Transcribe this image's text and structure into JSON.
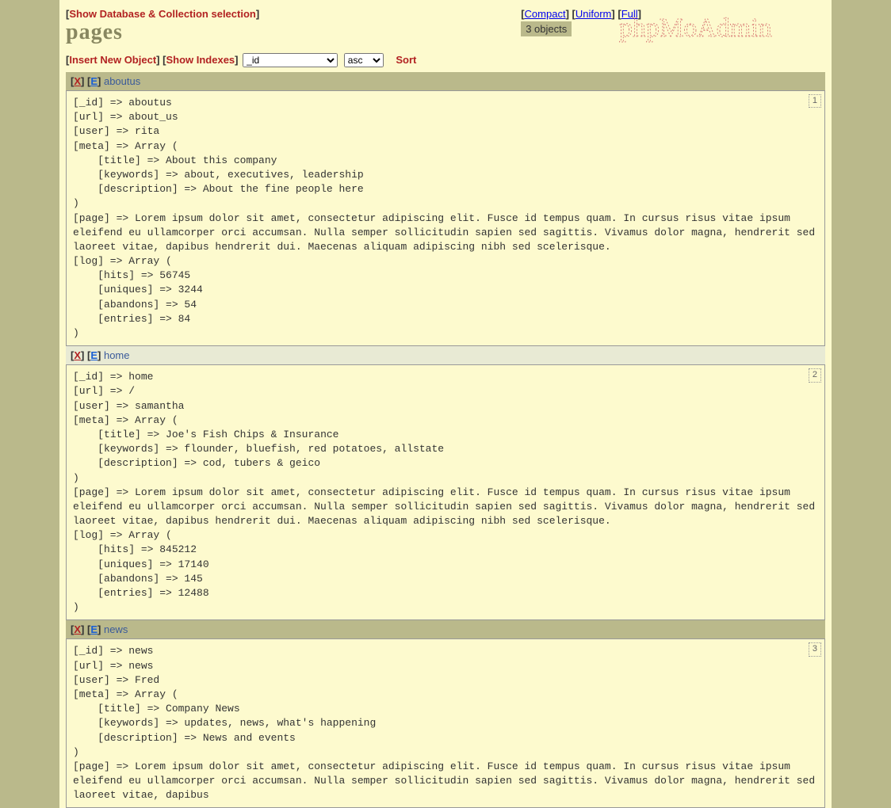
{
  "header": {
    "show_db_link": "Show Database & Collection selection",
    "collection_title": "pages",
    "insert_link": "Insert New Object",
    "show_indexes_link": "Show Indexes",
    "sort_field": "_id",
    "sort_dir": "asc",
    "sort_label": "Sort",
    "view_compact": "Compact",
    "view_uniform": "Uniform",
    "view_full": "Full",
    "object_count": "3 objects",
    "logo_text": "phpMoAdmin"
  },
  "actions": {
    "x": "X",
    "e": "E"
  },
  "documents": [
    {
      "index": "1",
      "header_class": "",
      "id_label": "aboutus",
      "body": "[_id] => aboutus\n[url] => about_us\n[user] => rita\n[meta] => Array (\n    [title] => About this company\n    [keywords] => about, executives, leadership\n    [description] => About the fine people here\n)\n[page] => Lorem ipsum dolor sit amet, consectetur adipiscing elit. Fusce id tempus quam. In cursus risus vitae ipsum eleifend eu ullamcorper orci accumsan. Nulla semper sollicitudin sapien sed sagittis. Vivamus dolor magna, hendrerit sed laoreet vitae, dapibus hendrerit dui. Maecenas aliquam adipiscing nibh sed scelerisque.\n[log] => Array (\n    [hits] => 56745\n    [uniques] => 3244\n    [abandons] => 54\n    [entries] => 84\n)"
    },
    {
      "index": "2",
      "header_class": "alt",
      "id_label": "home",
      "body": "[_id] => home\n[url] => /\n[user] => samantha\n[meta] => Array (\n    [title] => Joe's Fish Chips & Insurance\n    [keywords] => flounder, bluefish, red potatoes, allstate\n    [description] => cod, tubers & geico\n)\n[page] => Lorem ipsum dolor sit amet, consectetur adipiscing elit. Fusce id tempus quam. In cursus risus vitae ipsum eleifend eu ullamcorper orci accumsan. Nulla semper sollicitudin sapien sed sagittis. Vivamus dolor magna, hendrerit sed laoreet vitae, dapibus hendrerit dui. Maecenas aliquam adipiscing nibh sed scelerisque.\n[log] => Array (\n    [hits] => 845212\n    [uniques] => 17140\n    [abandons] => 145\n    [entries] => 12488\n)"
    },
    {
      "index": "3",
      "header_class": "",
      "id_label": "news",
      "body": "[_id] => news\n[url] => news\n[user] => Fred\n[meta] => Array (\n    [title] => Company News\n    [keywords] => updates, news, what's happening\n    [description] => News and events\n)\n[page] => Lorem ipsum dolor sit amet, consectetur adipiscing elit. Fusce id tempus quam. In cursus risus vitae ipsum eleifend eu ullamcorper orci accumsan. Nulla semper sollicitudin sapien sed sagittis. Vivamus dolor magna, hendrerit sed laoreet vitae, dapibus"
    }
  ]
}
